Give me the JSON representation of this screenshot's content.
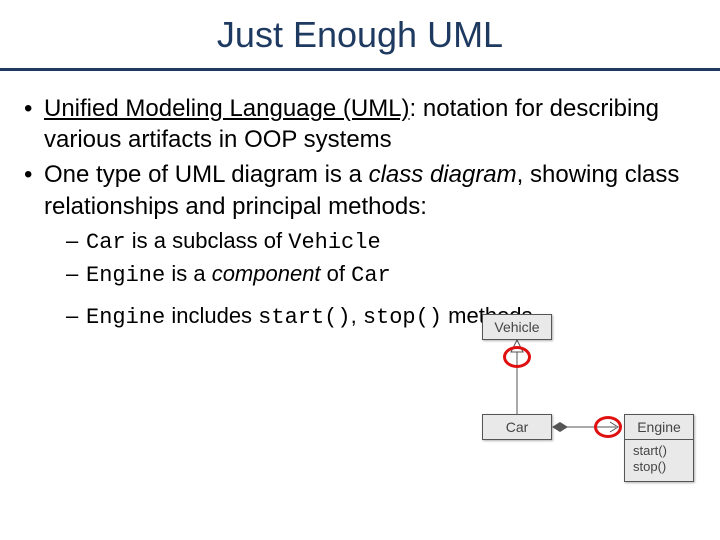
{
  "title": "Just Enough UML",
  "bullets": {
    "b1_bold": "Unified Modeling Language (UML)",
    "b1_rest": ": notation for describing various artifacts in OOP systems",
    "b2_a": "One type of UML diagram is a ",
    "b2_i": "class diagram",
    "b2_b": ", showing class relationships and principal methods:"
  },
  "sub": {
    "s1_code1": "Car",
    "s1_mid": " is a subclass of ",
    "s1_code2": "Vehicle",
    "s2_code1": "Engine",
    "s2_mid": " is a ",
    "s2_i": "component",
    "s2_mid2": " of ",
    "s2_code2": "Car",
    "s3_code1": "Engine",
    "s3_mid": " includes ",
    "s3_code2": "start()",
    "s3_mid2": ", ",
    "s3_code3": "stop()",
    "s3_end": " methods"
  },
  "diagram": {
    "vehicle": "Vehicle",
    "car": "Car",
    "engine": "Engine",
    "m1": "start()",
    "m2": "stop()"
  }
}
